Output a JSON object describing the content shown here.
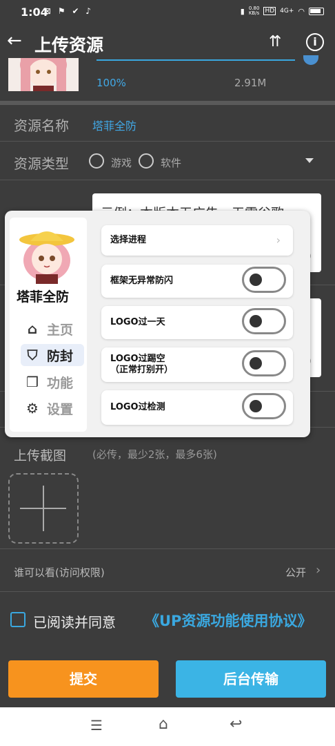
{
  "status_bar": {
    "time": "1:04",
    "network_speed": "0.80\nKB/s",
    "hd": "HD",
    "signal": "4G+"
  },
  "header": {
    "title": "上传资源"
  },
  "upload": {
    "percent": "100%",
    "size": "2.91M",
    "progress": 1.0
  },
  "form": {
    "name_label": "资源名称",
    "name_value": "塔菲全防",
    "type_label": "资源类型",
    "type_options": [
      "游戏",
      "软件"
    ],
    "bg_card1_text": "示例：本版本无广告，无需谷歌",
    "bg_card1_tail": "0",
    "bg_card2_tail": "0"
  },
  "overlay": {
    "brand": "塔菲全防",
    "nav": [
      {
        "label": "主页",
        "icon": "home-icon"
      },
      {
        "label": "防封",
        "icon": "shield-icon"
      },
      {
        "label": "功能",
        "icon": "cube-icon"
      },
      {
        "label": "设置",
        "icon": "gear-icon"
      }
    ],
    "active_nav": "防封",
    "options": {
      "select_process": "选择进程",
      "framework": "框架无异常防闪",
      "logo_day": "LOGO过一天",
      "logo_empty_1": "LOGO过踢空",
      "logo_empty_2": "（正常打别开）",
      "logo_detect": "LOGO过检测"
    }
  },
  "screenshots": {
    "label": "上传截图",
    "hint": "(必传，最少2张，最多6张)"
  },
  "visibility": {
    "label": "谁可以看(访问权限)",
    "value": "公开"
  },
  "agreement": {
    "prefix": "已阅读并同意",
    "link": "《UP资源功能使用协议》"
  },
  "buttons": {
    "submit": "提交",
    "background": "后台传输"
  },
  "colors": {
    "accent": "#3aa8e0",
    "submit": "#f7931e",
    "background_btn": "#3bb4e5"
  }
}
